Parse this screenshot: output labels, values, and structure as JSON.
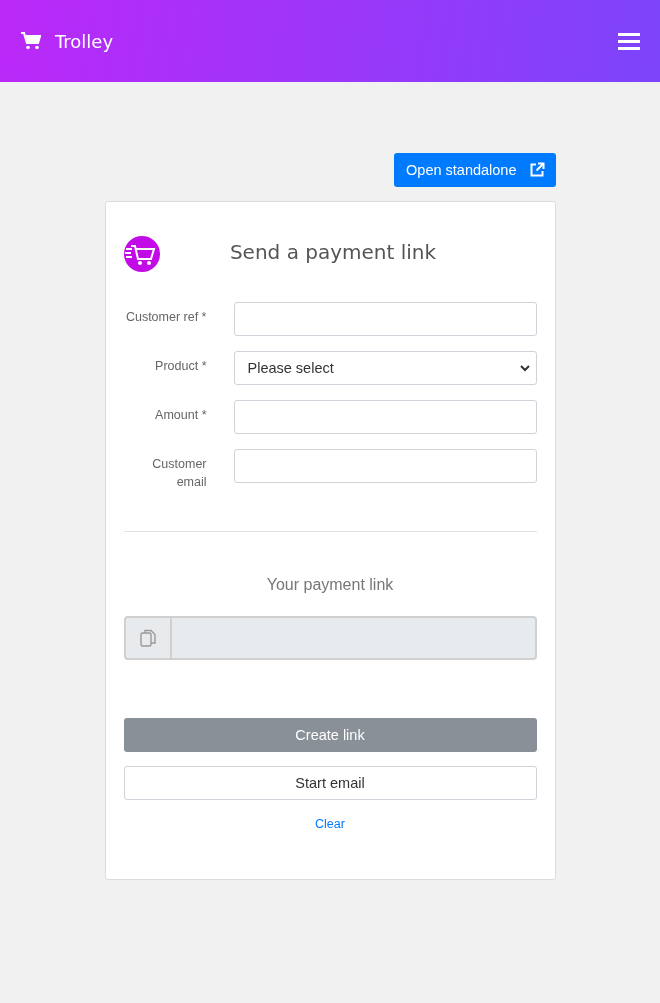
{
  "header": {
    "title": "Trolley"
  },
  "open_button": {
    "label": "Open standalone"
  },
  "form": {
    "title": "Send a payment link",
    "fields": [
      {
        "label": "Customer ref *",
        "kind": "text"
      },
      {
        "label": "Product *",
        "kind": "select",
        "value": "Please select"
      },
      {
        "label": "Amount *",
        "kind": "text"
      },
      {
        "label": "Customer email",
        "kind": "text"
      }
    ]
  },
  "result": {
    "title": "Your payment link",
    "disabled": true
  },
  "buttons": [
    {
      "label": "Create link",
      "kind": "primary",
      "disabled": true
    },
    {
      "label": "Start email",
      "kind": "outline",
      "disabled": false
    }
  ],
  "clear_link": "Clear"
}
